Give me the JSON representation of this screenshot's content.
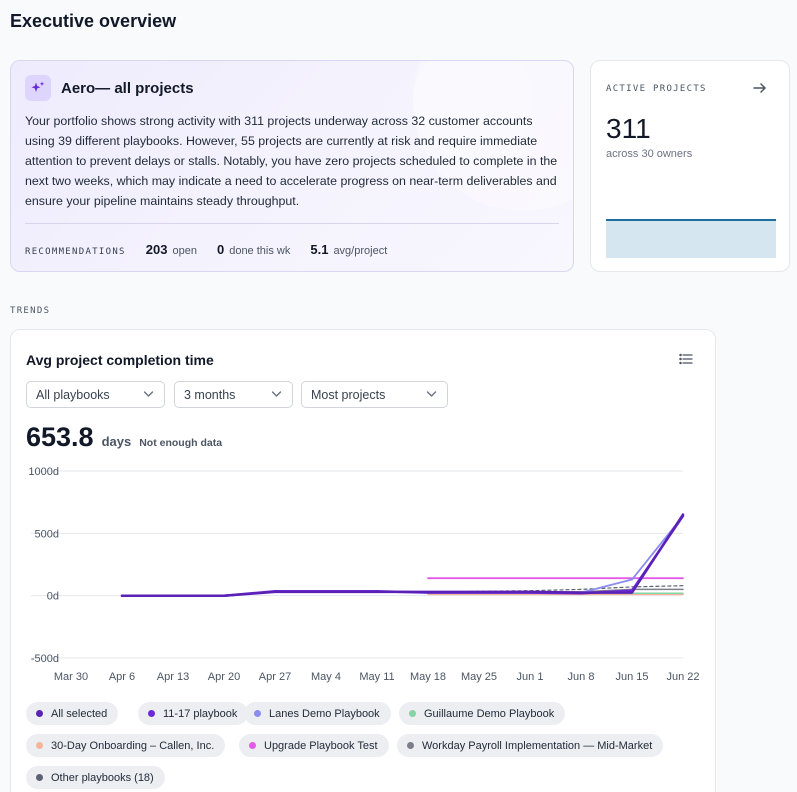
{
  "page": {
    "title": "Executive overview"
  },
  "aero": {
    "title": "Aero— all projects",
    "summary": "Your portfolio shows strong activity with 311 projects underway across 32 customer accounts using 39 different playbooks. However, 55 projects are currently at risk and require immediate attention to prevent delays or stalls. Notably, you have zero projects scheduled to complete in the next two weeks, which may indicate a need to accelerate progress on near-term deliverables and ensure your pipeline maintains steady throughput.",
    "recommendations_label": "RECOMMENDATIONS",
    "stats": [
      {
        "value": "203",
        "label": "open"
      },
      {
        "value": "0",
        "label": "done this wk"
      },
      {
        "value": "5.1",
        "label": "avg/project"
      }
    ]
  },
  "active_projects": {
    "label": "ACTIVE PROJECTS",
    "value": "311",
    "sub": "across 30 owners",
    "spark_color": "#1e6fa0",
    "spark_fill": "#d6e6f0"
  },
  "trends": {
    "label": "TRENDS"
  },
  "completion_chart": {
    "title": "Avg project completion time",
    "filters": [
      {
        "value": "All playbooks"
      },
      {
        "value": "3 months"
      },
      {
        "value": "Most projects"
      }
    ],
    "headline_value": "653.8",
    "headline_unit": "days",
    "headline_note": "Not enough data"
  },
  "chart_data": {
    "type": "line",
    "title": "Avg project completion time",
    "xlabel": "",
    "ylabel": "",
    "x": [
      "Mar 30",
      "Apr 6",
      "Apr 13",
      "Apr 20",
      "Apr 27",
      "May 4",
      "May 11",
      "May 18",
      "May 25",
      "Jun 1",
      "Jun 8",
      "Jun 15",
      "Jun 22"
    ],
    "y_ticks": [
      "1000d",
      "500d",
      "0d",
      "-500d"
    ],
    "ylim": [
      -500,
      1000
    ],
    "grid": true,
    "legend": "bottom",
    "series": [
      {
        "name": "All selected",
        "color": "#5b21b6",
        "width": 2.5,
        "x_start": 1,
        "values": [
          null,
          0,
          0,
          0,
          30,
          30,
          30,
          30,
          30,
          30,
          25,
          25,
          650
        ]
      },
      {
        "name": "11-17 playbook",
        "color": "#6d28d9",
        "width": 2.5,
        "x_start": 1,
        "values": [
          null,
          0,
          0,
          0,
          35,
          35,
          35,
          25,
          25,
          25,
          20,
          40,
          640
        ]
      },
      {
        "name": "Lanes Demo Playbook",
        "color": "#8b8cf0",
        "width": 1.8,
        "x_start": 7,
        "values": [
          null,
          null,
          null,
          null,
          null,
          null,
          null,
          25,
          25,
          25,
          25,
          130,
          640
        ]
      },
      {
        "name": "Guillaume Demo Playbook",
        "color": "#86d3a6",
        "width": 1.5,
        "x_start": 7,
        "values": [
          null,
          null,
          null,
          null,
          null,
          null,
          null,
          20,
          20,
          20,
          20,
          20,
          20
        ]
      },
      {
        "name": "30-Day Onboarding – Callen, Inc.",
        "color": "#f6b59a",
        "width": 1.5,
        "x_start": 7,
        "values": [
          null,
          null,
          null,
          null,
          null,
          null,
          null,
          10,
          10,
          10,
          10,
          10,
          10
        ]
      },
      {
        "name": "Upgrade Playbook Test",
        "color": "#e35ce8",
        "width": 1.8,
        "x_start": 7,
        "values": [
          null,
          null,
          null,
          null,
          null,
          null,
          null,
          140,
          140,
          140,
          140,
          140,
          140
        ]
      },
      {
        "name": "Workday Payroll Implementation — Mid-Market",
        "color": "#7b7f8c",
        "width": 1.5,
        "x_start": 7,
        "values": [
          null,
          null,
          null,
          null,
          null,
          null,
          null,
          30,
          30,
          30,
          30,
          50,
          50
        ]
      },
      {
        "name": "Other playbooks (18)",
        "color": "#5c6273",
        "width": 1.2,
        "dashed": true,
        "x_start": 7,
        "values": [
          null,
          null,
          null,
          null,
          null,
          null,
          null,
          25,
          35,
          40,
          50,
          70,
          80
        ]
      }
    ]
  },
  "legend": [
    {
      "label": "All selected",
      "color": "#5b21b6"
    },
    {
      "label": "11-17 playbook",
      "color": "#6d28d9"
    },
    {
      "label": "Lanes Demo Playbook",
      "color": "#8b8cf0"
    },
    {
      "label": "Guillaume Demo Playbook",
      "color": "#86d3a6"
    },
    {
      "label": "30-Day Onboarding – Callen, Inc.",
      "color": "#f6b59a"
    },
    {
      "label": "Upgrade Playbook Test",
      "color": "#e35ce8"
    },
    {
      "label": "Workday Payroll Implementation — Mid-Market",
      "color": "#7b7f8c"
    },
    {
      "label": "Other playbooks (18)",
      "color": "#5c6273"
    }
  ],
  "icons": {
    "aero": "sparkle-icon",
    "active_projects_link": "arrow-right-icon",
    "chart_menu": "list-icon",
    "dropdown": "chevron-down-icon"
  }
}
